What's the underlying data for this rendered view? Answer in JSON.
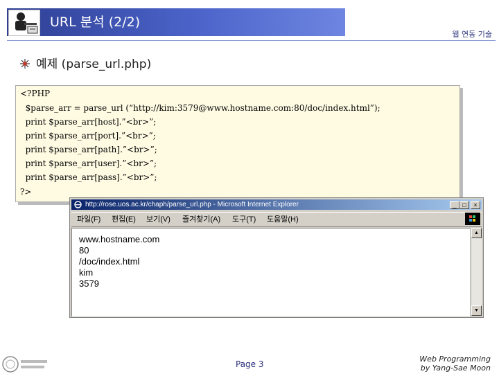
{
  "header": {
    "title": "URL 분석 (2/2)",
    "top_right": "웹 연동 기술"
  },
  "section": {
    "title": "예제 (parse_url.php)"
  },
  "code": {
    "lines": [
      "<?PHP",
      "  $parse_arr = parse_url (“http://kim:3579@www.hostname.com:80/doc/index.html”);",
      "  print $parse_arr[host].”<br>”;",
      "  print $parse_arr[port].”<br>”;",
      "  print $parse_arr[path].”<br>”;",
      "  print $parse_arr[user].”<br>”;",
      "  print $parse_arr[pass].”<br>”;",
      "?>"
    ]
  },
  "browser": {
    "title": "http://rose.uos.ac.kr/chaph/parse_url.php - Microsoft Internet Explorer",
    "menu": [
      "파일(F)",
      "편집(E)",
      "보기(V)",
      "즐겨찾기(A)",
      "도구(T)",
      "도움말(H)"
    ],
    "output": [
      "www.hostname.com",
      "80",
      "/doc/index.html",
      "kim",
      "3579"
    ],
    "window_buttons": [
      "_",
      "□",
      "×"
    ]
  },
  "footer": {
    "page": "Page 3",
    "credit_line1": "Web Programming",
    "credit_line2": "by Yang-Sae Moon"
  },
  "colors": {
    "title_band": "#2e3f93",
    "code_background": "#fffbe3",
    "page_number": "#2a2f7a"
  }
}
